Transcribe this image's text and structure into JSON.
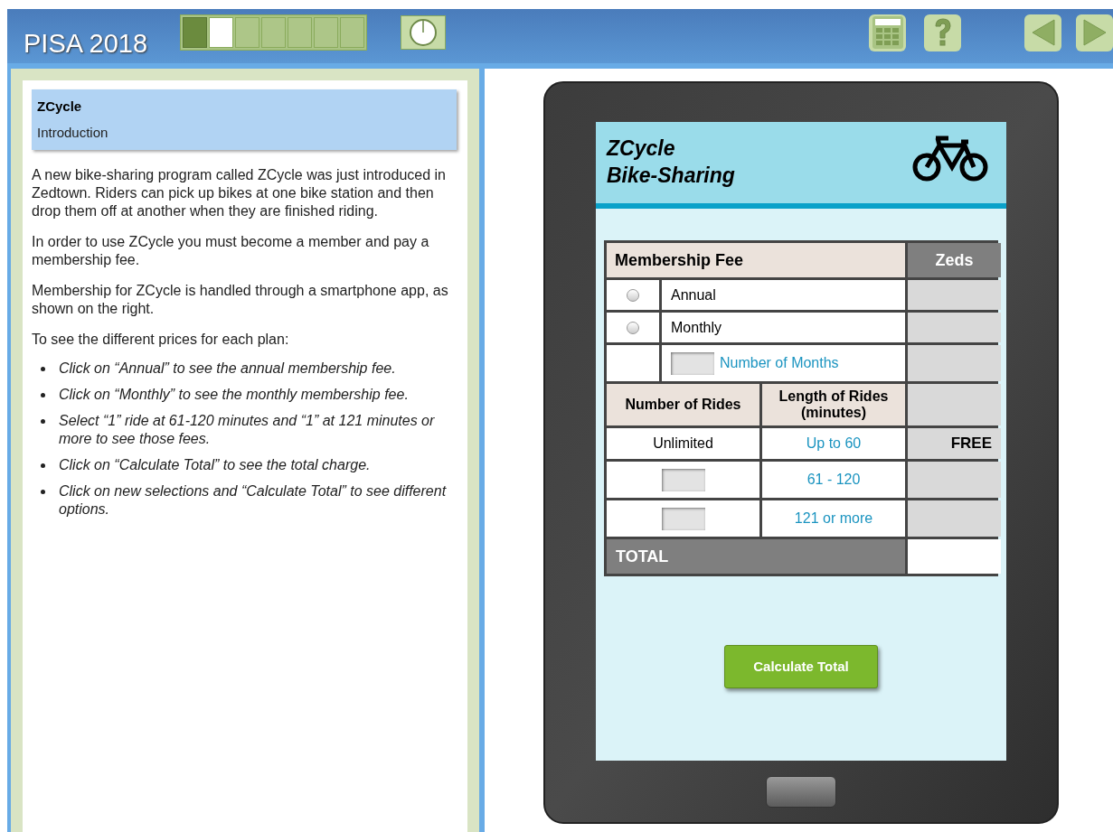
{
  "header": {
    "title": "PISA 2018",
    "progress": [
      {
        "completed": true,
        "selected": false
      },
      {
        "completed": false,
        "selected": true
      },
      {
        "completed": false,
        "selected": false
      },
      {
        "completed": false,
        "selected": false
      },
      {
        "completed": false,
        "selected": false
      },
      {
        "completed": false,
        "selected": false
      },
      {
        "completed": false,
        "selected": false
      }
    ]
  },
  "stimulus": {
    "title": "ZCycle",
    "subtitle": "Introduction",
    "paragraphs": [
      "A new bike-sharing program called ZCycle was just introduced in Zedtown. Riders can pick up bikes at one bike station and then drop them off at another when they are finished riding.",
      "In order to use ZCycle you must become a member and pay a membership fee.",
      "Membership for ZCycle is handled through a smartphone app, as shown on the right.",
      "To see the different prices for each plan:"
    ],
    "instructions": [
      "Click on “Annual” to see the annual membership fee.",
      "Click on “Monthly” to see the monthly membership fee.",
      "Select “1” ride at 61-120 minutes and “1” at 121 minutes or more to see those fees.",
      "Click on “Calculate Total” to see the total charge.",
      "Click on new selections and “Calculate Total” to see different options."
    ]
  },
  "app": {
    "title_lines": [
      "ZCycle",
      "Bike-Sharing"
    ],
    "table": {
      "fee_header": "Membership Fee",
      "zeds_header": "Zeds",
      "plans": [
        {
          "label": "Annual",
          "selected": false
        },
        {
          "label": "Monthly",
          "selected": false
        }
      ],
      "months_label": "Number of Months",
      "rides_headers": [
        "Number of Rides",
        "Length of Rides (minutes)"
      ],
      "rides": [
        {
          "kind": "fixed",
          "count": "Unlimited",
          "length": "Up to 60",
          "fee": "FREE"
        },
        {
          "kind": "input",
          "length": "61 - 120"
        },
        {
          "kind": "input",
          "length": "121 or more"
        }
      ],
      "total_label": "TOTAL"
    },
    "button": "Calculate Total"
  }
}
